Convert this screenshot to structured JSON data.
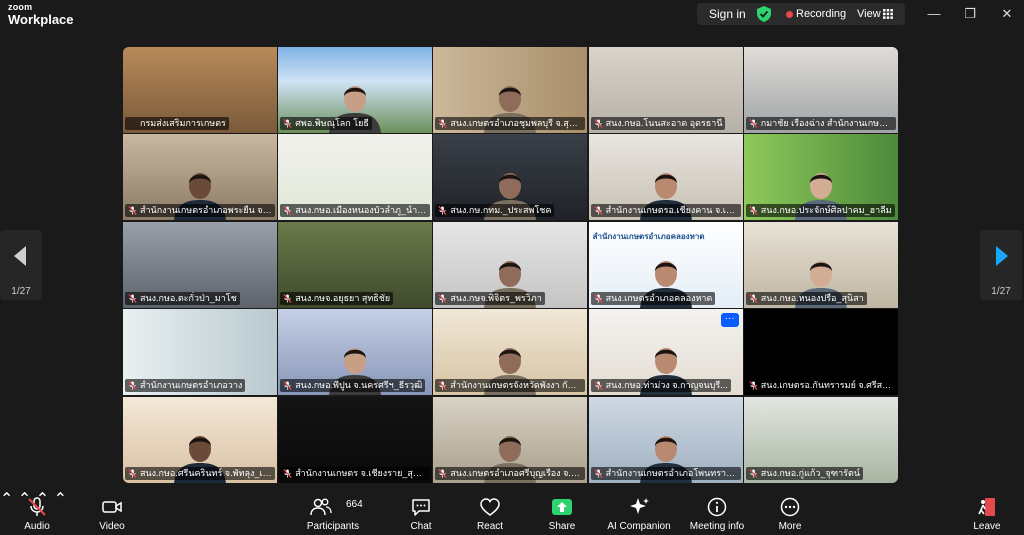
{
  "app": {
    "logo_line1": "zoom",
    "logo_line2": "Workplace"
  },
  "titlebar": {
    "sign_in": "Sign in",
    "recording": "Recording",
    "view": "View",
    "minimize": "—",
    "maximize": "❐",
    "close": "✕"
  },
  "colors": {
    "accent": "#0b5cff",
    "active_speaker": "#2dd36f",
    "muted": "#e5484d",
    "shield": "#2dd36f"
  },
  "pager": {
    "left_page": "1/27",
    "right_page": "1/27"
  },
  "participants": [
    {
      "name": "กรมส่งเสริมการเกษตร",
      "muted": false,
      "active": true
    },
    {
      "name": "ศพอ.พิษณุโลก โยธี",
      "muted": true
    },
    {
      "name": "สนง.เกษตรอำเภอชุมพลบุรี จ.สุริน...",
      "muted": true
    },
    {
      "name": "สนง.กษอ.โนนสะอาด อุดรธานี",
      "muted": true
    },
    {
      "name": "กมาชัย เรืองฉ่าง สำนักงานเกษตร...",
      "muted": true
    },
    {
      "name": "สำนักงานเกษตรอำเภอพระยืน จ.ข...",
      "muted": true
    },
    {
      "name": "สนง.กษอ.เมืองหนองบัวลำภู_นำทิ...",
      "muted": true
    },
    {
      "name": "สนง.กษ.กทม._ประสพโชค",
      "muted": true
    },
    {
      "name": "สำนักงานเกษตรอ.เชียงคาน จ.เลย...",
      "muted": true
    },
    {
      "name": "สนง.กษอ.ประจักษ์ศิลปาคม_ฮาลีม",
      "muted": true
    },
    {
      "name": "สนง.กษอ.ตะกั่วป่า_มาโช",
      "muted": true
    },
    {
      "name": "สนง.กษจ.อยุธยา สุทธิชัย",
      "muted": true
    },
    {
      "name": "สนง.กษจ.พิจิตร_พรวิภา",
      "muted": true
    },
    {
      "name": "สนง.เกษตรอำเภอคลองหาด",
      "muted": true,
      "slide_text": "สำนักงานเกษตรอำเภอคลองหาด"
    },
    {
      "name": "สนง.กษอ.หนองปรือ_สุนิสา",
      "muted": true
    },
    {
      "name": "สำนักงานเกษตรอำเภอวาง",
      "muted": true
    },
    {
      "name": "สนง.กษอ.พีปูน จ.นครศรีฯ_ธีรวุฒิ",
      "muted": true
    },
    {
      "name": "สำนักงานเกษตรจังหวัดพังงา กันต์...",
      "muted": true
    },
    {
      "name": "สนง.กษอ.ท่าม่วง จ.กาญจนบุรี...",
      "muted": true,
      "more": "···"
    },
    {
      "name": "สนง.เกษตรอ.กันทรารมย์ จ.ศรีสะเ...",
      "muted": true
    },
    {
      "name": "สนง.กษอ.ศรีนครินทร์ จ.พัทลุง_เอ็...",
      "muted": true
    },
    {
      "name": "สำนักงานเกษตร จ.เชียงราย_สุธากร",
      "muted": true
    },
    {
      "name": "สนง.เกษตรอำเภอศรีบุญเรือง จ.ห...",
      "muted": true
    },
    {
      "name": "สำนักงานเกษตรอำเภอโพนทราย จ.ร้อ...",
      "muted": true
    },
    {
      "name": "สนง.กษอ.กู่แก้ว_จุฑารัตน์",
      "muted": true
    }
  ],
  "toolbar": {
    "audio": "Audio",
    "video": "Video",
    "participants": "Participants",
    "participants_count": "664",
    "chat": "Chat",
    "react": "React",
    "share": "Share",
    "ai_companion": "AI Companion",
    "meeting_info": "Meeting info",
    "more": "More",
    "leave": "Leave"
  }
}
